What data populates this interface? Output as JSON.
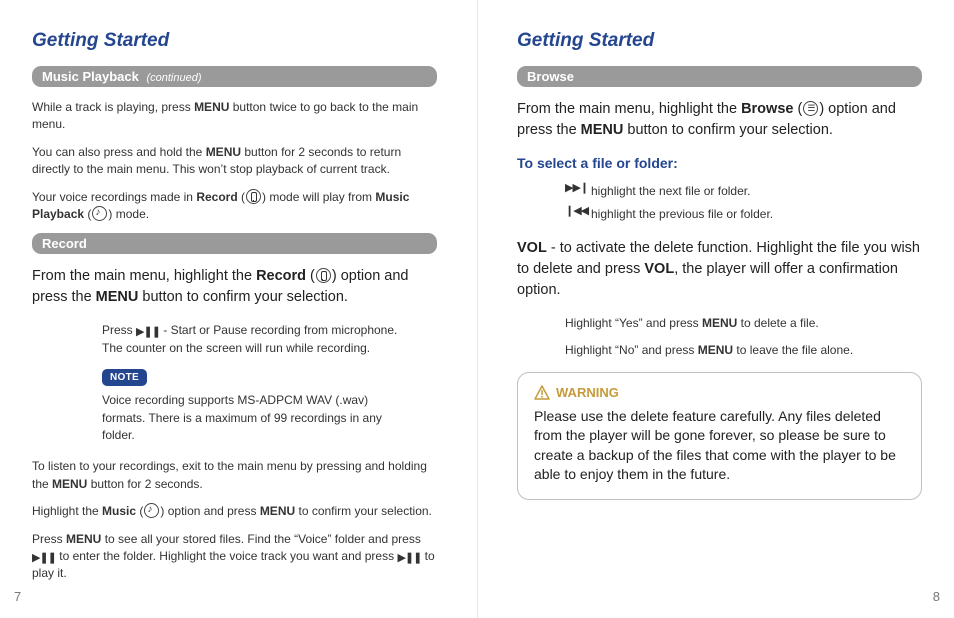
{
  "left": {
    "title": "Getting Started",
    "section1_label": "Music Playback",
    "section1_cont": "(continued)",
    "p1a": "While a track is playing, press ",
    "p1b": " button twice to go back to the main menu.",
    "p2a": "You can also press and hold the ",
    "p2b": " button for 2 seconds to return directly to the main menu. This won’t stop playback of current track.",
    "p3a": "Your voice recordings made in ",
    "p3b": " (",
    "p3c": ") mode will play from ",
    "p3d": " (",
    "p3e": ") mode.",
    "section2_label": "Record",
    "rec_lead_a": "From the main menu, highlight the ",
    "rec_lead_b": " (",
    "rec_lead_c": ") option and press the ",
    "rec_lead_d": " button to confirm your selection.",
    "rec_press_a": "Press ",
    "rec_press_b": " - Start or Pause recording from microphone. The counter on the screen will run while recording.",
    "note_label": "NOTE",
    "note_text": "Voice recording supports MS-ADPCM WAV (.wav) formats. There is a maximum of 99 recordings in any folder.",
    "listen_a": "To listen to your recordings, exit to the main menu by pressing and holding the ",
    "listen_b": " button for 2 seconds.",
    "hilite_a": "Highlight the ",
    "hilite_b": " (",
    "hilite_c": ")  option and press ",
    "hilite_d": " to confirm your selection.",
    "stored_a": "Press ",
    "stored_b": " to see all your stored files. Find the “Voice” folder and press ",
    "stored_c": " to enter the folder. Highlight the voice track you want and press ",
    "stored_d": " to play it.",
    "page_num": "7",
    "bold_menu": "MENU",
    "bold_record": "Record",
    "bold_music_playback": "Music Playback",
    "bold_music": "Music"
  },
  "right": {
    "title": "Getting Started",
    "section_label": "Browse",
    "lead_a": "From the main menu, highlight the ",
    "lead_b": " (",
    "lead_c": ") option and press the ",
    "lead_d": " button to confirm your selection.",
    "sub": "To select a file or folder:",
    "next_text": "highlight the next file or folder.",
    "prev_text": "highlight the previous file or folder.",
    "vol_a": " - to activate the delete function. Highlight the file you wish to delete and press ",
    "vol_b": ", the player will offer a confirmation option.",
    "yes_a": "Highlight “Yes” and press ",
    "yes_b": " to delete a file.",
    "no_a": "Highlight “No” and press ",
    "no_b": " to leave the file alone.",
    "warn_label": "WARNING",
    "warn_text": "Please use the delete feature carefully. Any files deleted from the player will be gone forever, so please be sure to create a backup of the files that come with the player to be able to enjoy them in the future.",
    "page_num": "8",
    "bold_menu": "MENU",
    "bold_browse": "Browse",
    "bold_vol": "VOL"
  }
}
